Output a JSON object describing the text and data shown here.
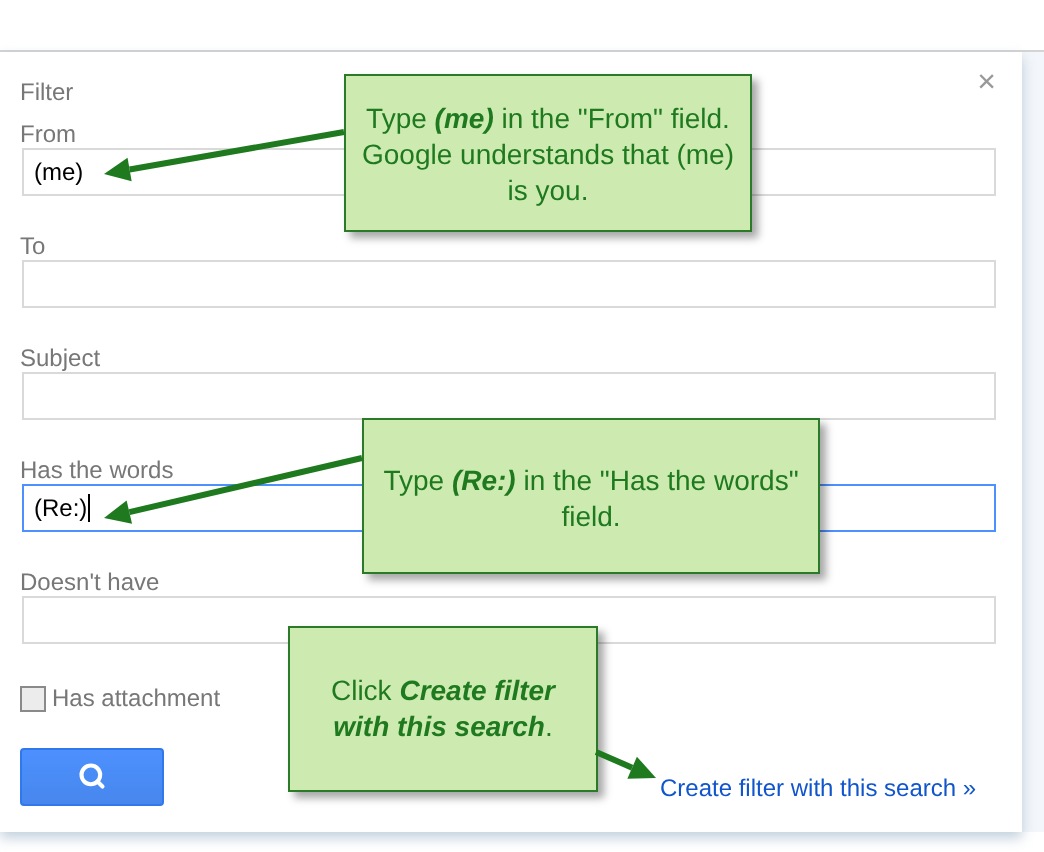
{
  "dialog": {
    "title": "Filter",
    "close": "×",
    "fields": [
      {
        "label": "From",
        "value": "(me)",
        "focused": false
      },
      {
        "label": "To",
        "focused": false
      },
      {
        "label": "Subject",
        "focused": false
      },
      {
        "label": "Has the words",
        "value": "(Re:)",
        "focused": true
      },
      {
        "label": "Doesn't have",
        "focused": false
      }
    ],
    "checkbox": {
      "label": "Has attachment",
      "checked": false
    },
    "link": "Create filter with this search »"
  },
  "callouts": [
    {
      "text": "Type **(me)** in the \"From\" field. Google understands that (me) is you."
    },
    {
      "text": "Type **(Re:)** in the \"Has the words\" field."
    },
    {
      "text": "Click **Create filter with this search**."
    }
  ]
}
